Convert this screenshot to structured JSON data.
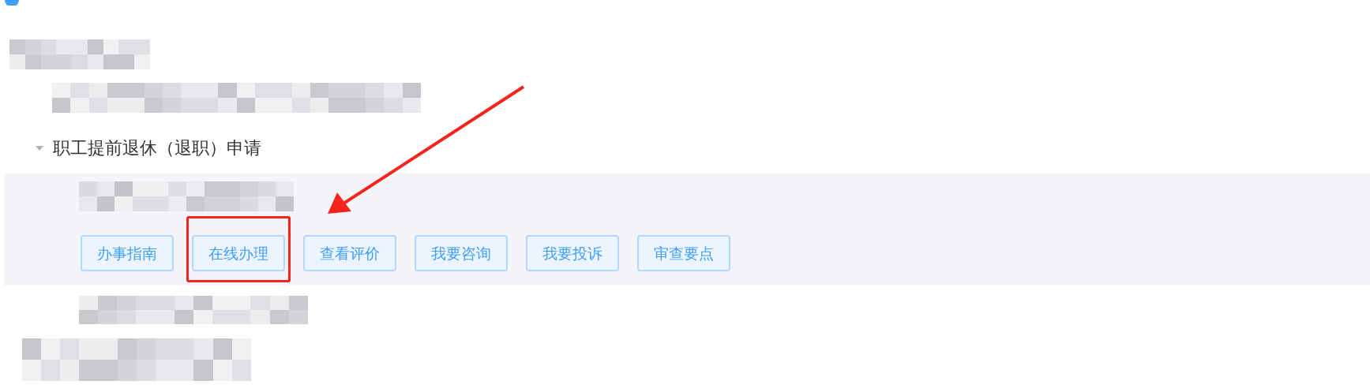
{
  "section": {
    "title": "职工提前退休（退职）申请",
    "expanded": true,
    "actions": [
      {
        "label": "办事指南",
        "highlighted": false
      },
      {
        "label": "在线办理",
        "highlighted": true
      },
      {
        "label": "查看评价",
        "highlighted": false
      },
      {
        "label": "我要咨询",
        "highlighted": false
      },
      {
        "label": "我要投诉",
        "highlighted": false
      },
      {
        "label": "审查要点",
        "highlighted": false
      }
    ]
  }
}
